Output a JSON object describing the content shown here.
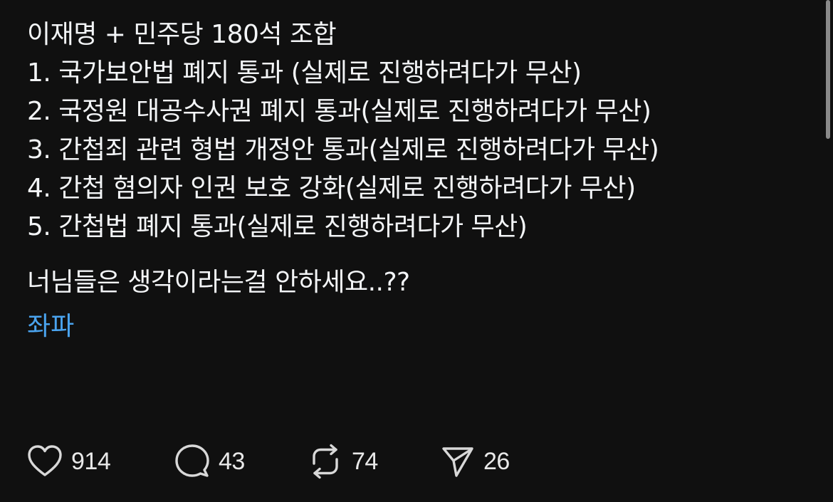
{
  "post": {
    "lines": [
      "이재명 + 민주당 180석 조합",
      "1. 국가보안법 폐지 통과 (실제로 진행하려다가 무산)",
      "2. 국정원 대공수사권 폐지 통과(실제로 진행하려다가 무산)",
      "3. 간첩죄 관련 형법 개정안 통과(실제로 진행하려다가 무산)",
      "4. 간첩 혐의자 인권 보호 강화(실제로 진행하려다가 무산)",
      "5. 간첩법 폐지 통과(실제로 진행하려다가 무산)"
    ],
    "closing": "너님들은 생각이라는걸 안하세요..??",
    "tag": "좌파"
  },
  "actions": {
    "like_count": "914",
    "reply_count": "43",
    "repost_count": "74",
    "share_count": "26"
  },
  "icons": {
    "like": "heart-icon",
    "reply": "speech-bubble-icon",
    "repost": "repost-arrows-icon",
    "share": "paper-plane-icon"
  },
  "colors": {
    "background": "#101010",
    "text": "#f3f5f7",
    "tag": "#4aa3ee",
    "icon": "#d8d8d8"
  }
}
